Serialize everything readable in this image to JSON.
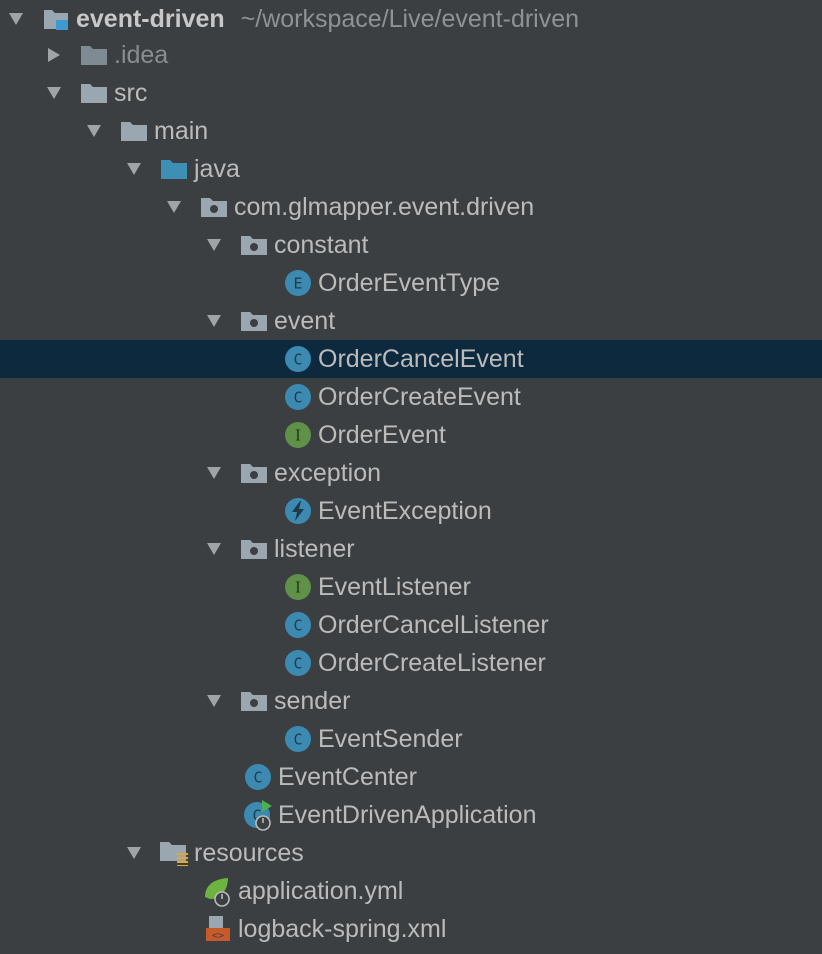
{
  "project_tree": {
    "root": {
      "label": "event-driven",
      "path": "~/workspace/Live/event-driven"
    },
    "idea": {
      "label": ".idea"
    },
    "src": {
      "label": "src"
    },
    "main": {
      "label": "main"
    },
    "java": {
      "label": "java"
    },
    "package": {
      "label": "com.glmapper.event.driven"
    },
    "constant": {
      "label": "constant"
    },
    "order_event_type": {
      "label": "OrderEventType",
      "badge": "E"
    },
    "event": {
      "label": "event"
    },
    "order_cancel_event": {
      "label": "OrderCancelEvent",
      "badge": "C"
    },
    "order_create_event": {
      "label": "OrderCreateEvent",
      "badge": "C"
    },
    "order_event": {
      "label": "OrderEvent",
      "badge": "I"
    },
    "exception": {
      "label": "exception"
    },
    "event_exception": {
      "label": "EventException"
    },
    "listener": {
      "label": "listener"
    },
    "event_listener": {
      "label": "EventListener",
      "badge": "I"
    },
    "order_cancel_listener": {
      "label": "OrderCancelListener",
      "badge": "C"
    },
    "order_create_listener": {
      "label": "OrderCreateListener",
      "badge": "C"
    },
    "sender": {
      "label": "sender"
    },
    "event_sender": {
      "label": "EventSender",
      "badge": "C"
    },
    "event_center": {
      "label": "EventCenter",
      "badge": "C"
    },
    "event_driven_application": {
      "label": "EventDrivenApplication",
      "badge": "C"
    },
    "resources": {
      "label": "resources"
    },
    "application_yml": {
      "label": "application.yml"
    },
    "logback_xml": {
      "label": "logback-spring.xml"
    }
  },
  "colors": {
    "background": "#3c3f41",
    "selection": "#0d293e",
    "text": "#bbbbbb",
    "class_badge": "#3c8ab1",
    "interface_badge": "#5f9149",
    "folder": "#9aa7b0",
    "source_folder": "#3d8fb5"
  }
}
